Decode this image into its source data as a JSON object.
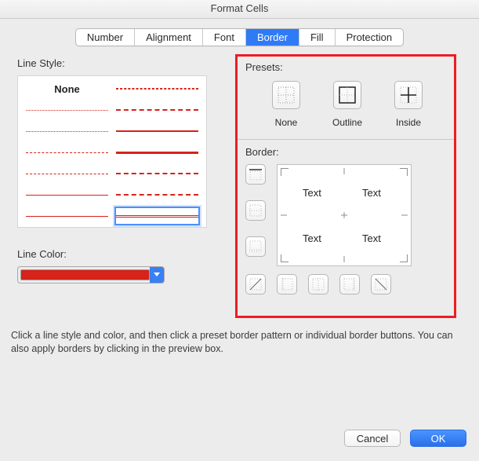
{
  "title": "Format Cells",
  "tabs": [
    "Number",
    "Alignment",
    "Font",
    "Border",
    "Fill",
    "Protection"
  ],
  "active_tab_index": 3,
  "left": {
    "line_style_label": "Line Style:",
    "none_label": "None",
    "line_color_label": "Line Color:",
    "line_color_value": "#d6231b",
    "selected_style_index": 12
  },
  "right": {
    "presets_label": "Presets:",
    "presets": [
      {
        "name": "none",
        "label": "None"
      },
      {
        "name": "outline",
        "label": "Outline"
      },
      {
        "name": "inside",
        "label": "Inside"
      }
    ],
    "border_label": "Border:",
    "preview_cells": [
      "Text",
      "Text",
      "Text",
      "Text"
    ],
    "side_buttons": [
      "top",
      "horizontal",
      "bottom"
    ],
    "bottom_buttons": [
      "diag-up",
      "left",
      "vertical",
      "right",
      "diag-down"
    ]
  },
  "help_text": "Click a line style and color, and then click a preset border pattern or individual border buttons. You can also apply borders by clicking in the preview box.",
  "footer": {
    "cancel": "Cancel",
    "ok": "OK"
  }
}
